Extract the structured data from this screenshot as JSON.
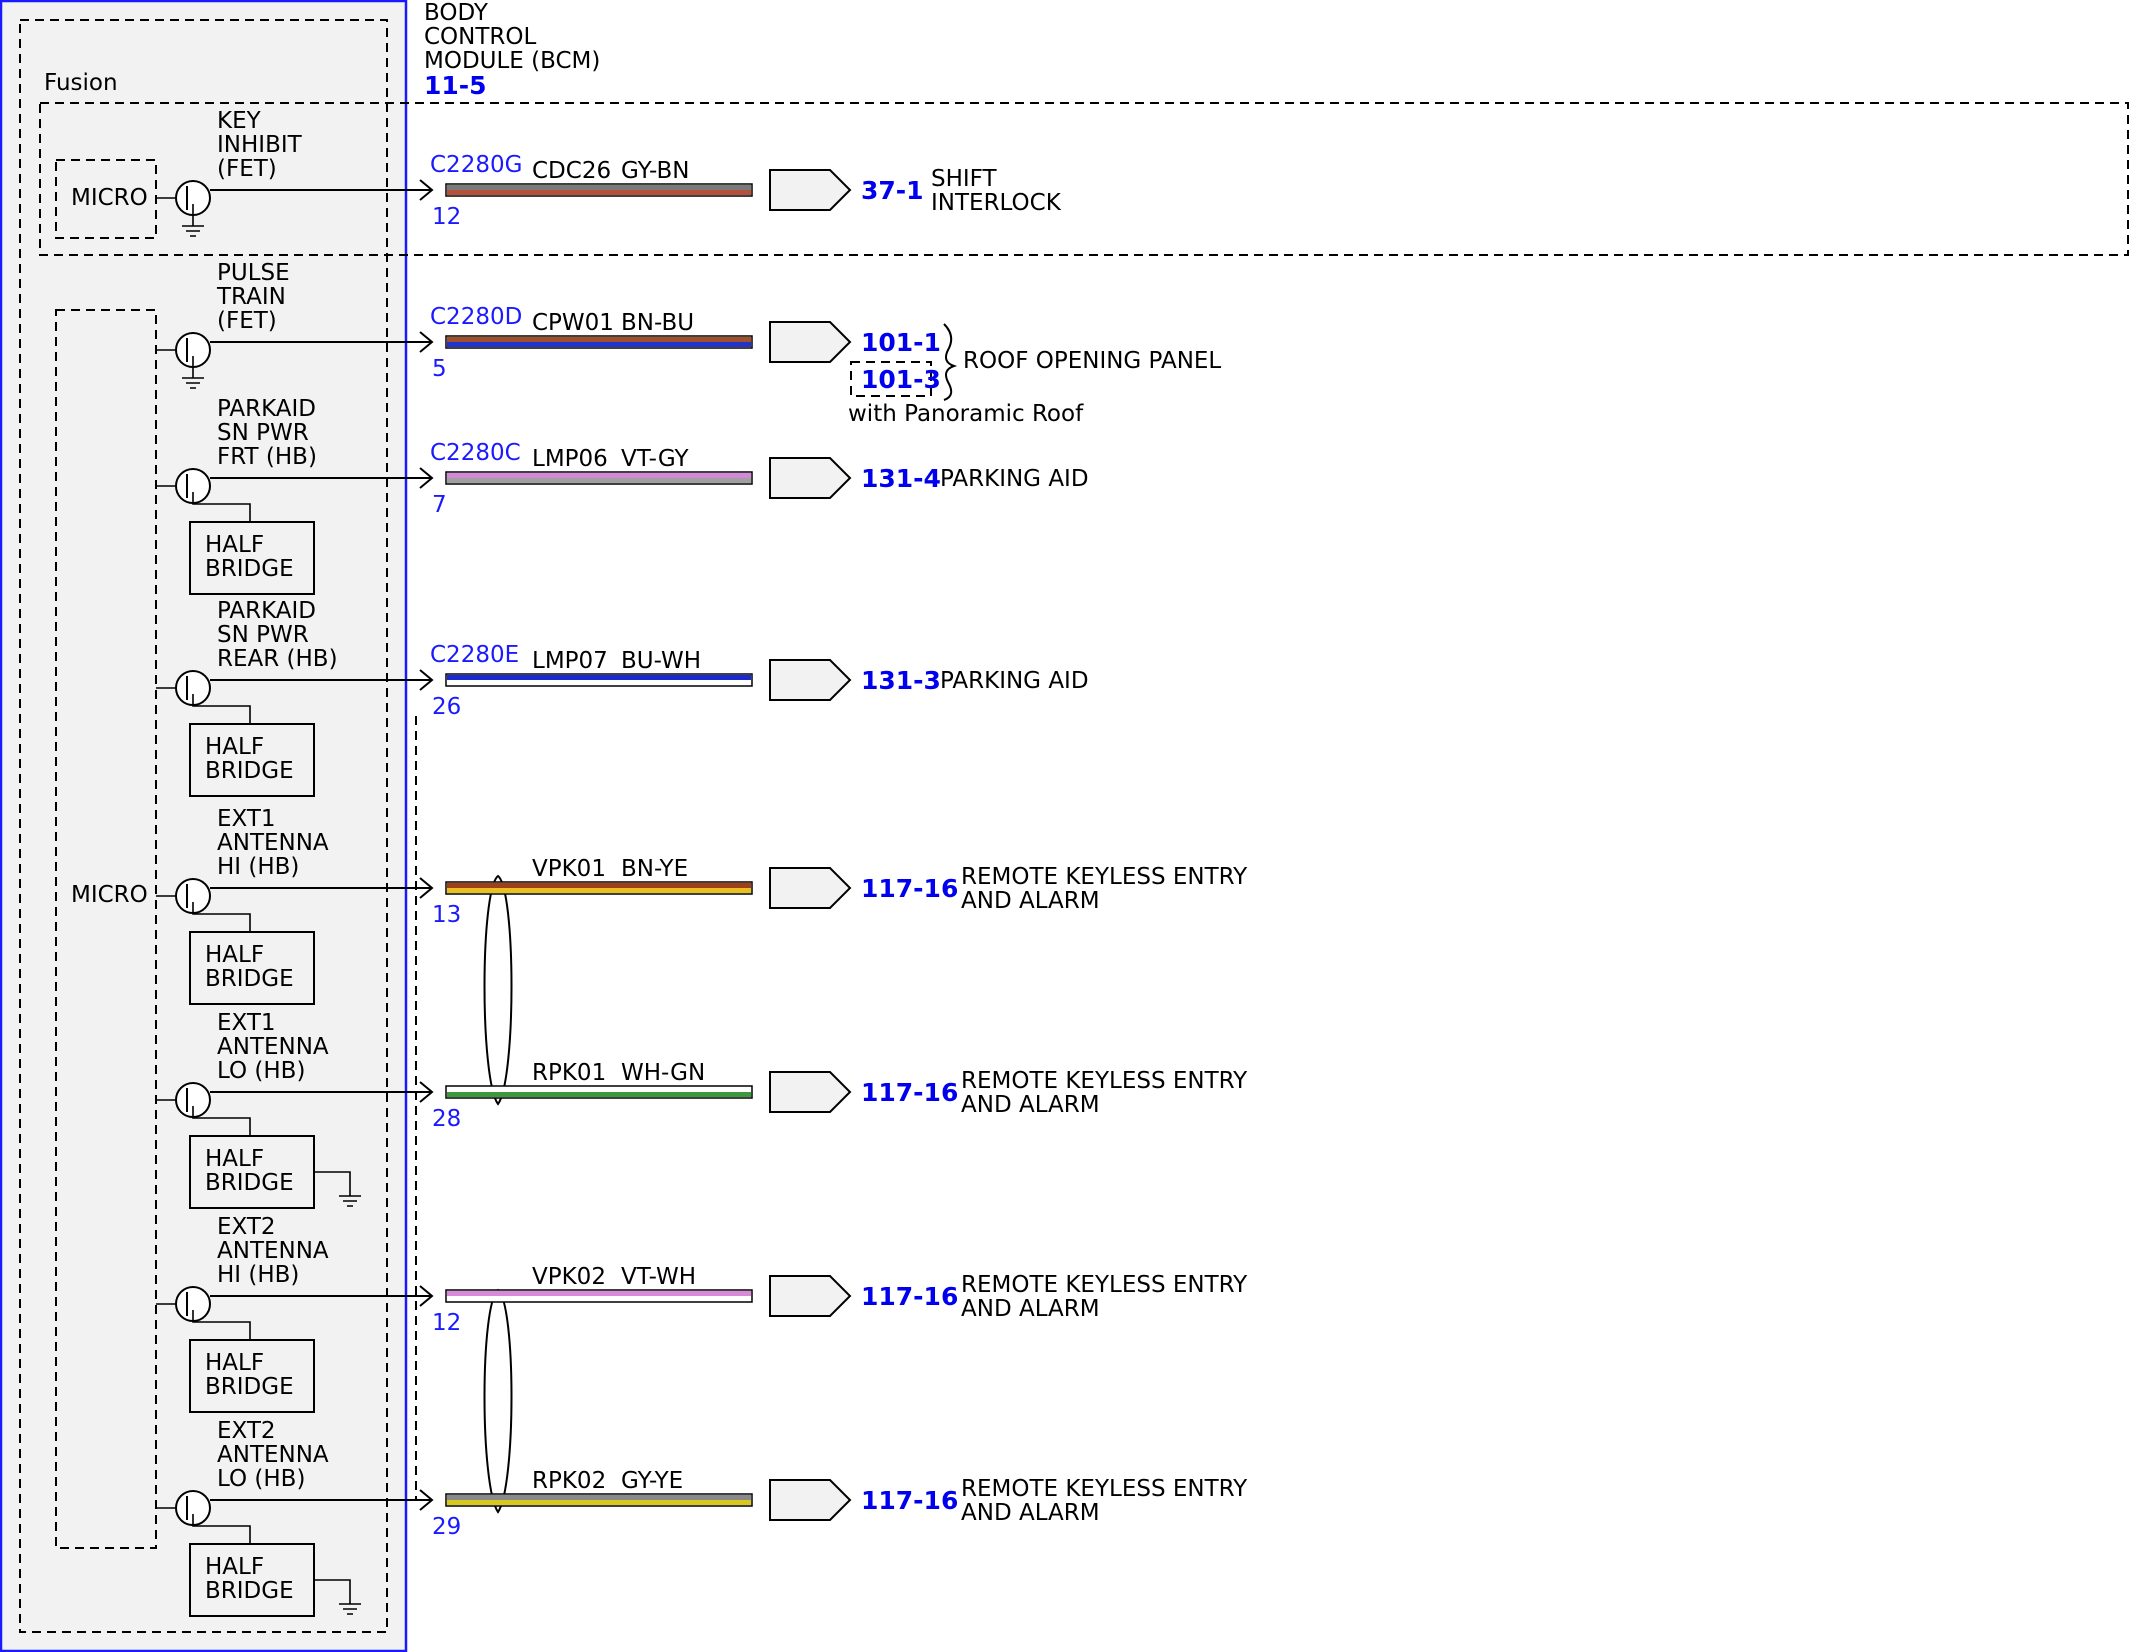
{
  "module": {
    "title_lines": [
      "BODY",
      "CONTROL",
      "MODULE (BCM)"
    ],
    "ref": "11-5",
    "fusion_label": "Fusion"
  },
  "micro_labels": [
    "MICRO",
    "MICRO"
  ],
  "half_bridge_lines": [
    "HALF",
    "BRIDGE"
  ],
  "circuits": [
    {
      "driver": [
        "KEY",
        "INHIBIT",
        "(FET)"
      ],
      "connector": "C2280G",
      "pin": "12",
      "circuit": "CDC26",
      "color": "GY-BN",
      "wire": [
        "#7a7a7a",
        "#b4503c"
      ],
      "ref": "37-1",
      "dest": [
        "SHIFT",
        "INTERLOCK"
      ]
    },
    {
      "driver": [
        "PULSE",
        "TRAIN",
        "(FET)"
      ],
      "connector": "C2280D",
      "pin": "5",
      "circuit": "CPW01",
      "color": "BN-BU",
      "wire": [
        "#a0502a",
        "#2233cc"
      ],
      "ref": "101-1",
      "ref_alt": "101-3",
      "dest": [
        "ROOF OPENING PANEL"
      ],
      "note": "with Panoramic Roof"
    },
    {
      "driver": [
        "PARKAID",
        "SN PWR",
        "FRT (HB)"
      ],
      "connector": "C2280C",
      "pin": "7",
      "circuit": "LMP06",
      "color": "VT-GY",
      "wire": [
        "#d28ad8",
        "#a0a0a0"
      ],
      "ref": "131-4",
      "dest": [
        "PARKING AID"
      ]
    },
    {
      "driver": [
        "PARKAID",
        "SN PWR",
        "REAR (HB)"
      ],
      "connector": "C2280E",
      "pin": "26",
      "circuit": "LMP07",
      "color": "BU-WH",
      "wire": [
        "#1a2ad0",
        "#ffffff"
      ],
      "ref": "131-3",
      "dest": [
        "PARKING AID"
      ]
    },
    {
      "driver": [
        "EXT1",
        "ANTENNA",
        "HI (HB)"
      ],
      "connector": "",
      "pin": "13",
      "circuit": "VPK01",
      "color": "BN-YE",
      "wire": [
        "#a0401a",
        "#e8c020"
      ],
      "ref": "117-16",
      "dest": [
        "REMOTE KEYLESS ENTRY",
        "AND ALARM"
      ]
    },
    {
      "driver": [
        "EXT1",
        "ANTENNA",
        "LO (HB)"
      ],
      "connector": "",
      "pin": "28",
      "circuit": "RPK01",
      "color": "WH-GN",
      "wire": [
        "#ffffff",
        "#3c9a3c"
      ],
      "ref": "117-16",
      "dest": [
        "REMOTE KEYLESS ENTRY",
        "AND ALARM"
      ]
    },
    {
      "driver": [
        "EXT2",
        "ANTENNA",
        "HI (HB)"
      ],
      "connector": "",
      "pin": "12",
      "circuit": "VPK02",
      "color": "VT-WH",
      "wire": [
        "#d88ad8",
        "#ffffff"
      ],
      "ref": "117-16",
      "dest": [
        "REMOTE KEYLESS ENTRY",
        "AND ALARM"
      ]
    },
    {
      "driver": [
        "EXT2",
        "ANTENNA",
        "LO (HB)"
      ],
      "connector": "",
      "pin": "29",
      "circuit": "RPK02",
      "color": "GY-YE",
      "wire": [
        "#8a8a8a",
        "#d8c820"
      ],
      "ref": "117-16",
      "dest": [
        "REMOTE KEYLESS ENTRY",
        "AND ALARM"
      ]
    }
  ]
}
